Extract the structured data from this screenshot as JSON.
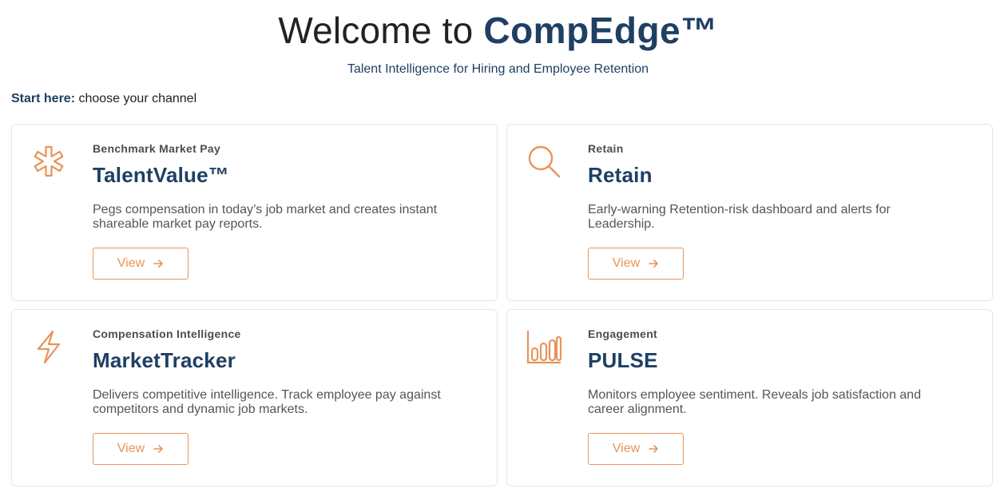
{
  "hero": {
    "title_prefix": "Welcome to ",
    "title_brand": "CompEdge™",
    "subtitle": "Talent Intelligence for Hiring and Employee Retention"
  },
  "start": {
    "label": "Start here:",
    "text": " choose your channel"
  },
  "colors": {
    "accent": "#e8945a",
    "brand": "#1f3f63"
  },
  "cards": [
    {
      "icon": "asterisk-icon",
      "eyebrow": "Benchmark Market Pay",
      "title": "TalentValue™",
      "description": "Pegs compensation in today’s job market and creates instant shareable market pay reports.",
      "button_label": "View"
    },
    {
      "icon": "search-icon",
      "eyebrow": "Retain",
      "title": "Retain",
      "description": "Early-warning Retention-risk dashboard and alerts for Leadership.",
      "button_label": "View"
    },
    {
      "icon": "lightning-icon",
      "eyebrow": "Compensation Intelligence",
      "title": "MarketTracker",
      "description": "Delivers competitive intelligence. Track employee pay against competitors and dynamic job markets.",
      "button_label": "View"
    },
    {
      "icon": "bar-chart-icon",
      "eyebrow": "Engagement",
      "title": "PULSE",
      "description": "Monitors employee sentiment. Reveals job satisfaction and career alignment.",
      "button_label": "View"
    }
  ]
}
